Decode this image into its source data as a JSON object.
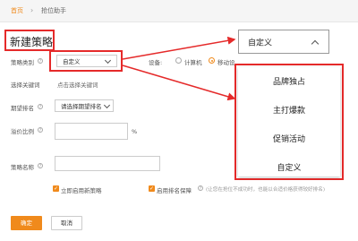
{
  "breadcrumb": {
    "home": "首页",
    "separator": "›",
    "current": "抢位助手"
  },
  "page_title": "新建策略",
  "form": {
    "strategy_type_label": "策略类别",
    "strategy_type_value": "自定义",
    "device_label": "设备:",
    "device_options": [
      "计算机",
      "移动设"
    ],
    "device_selected": "移动设",
    "keyword_label": "选择关键词",
    "keyword_link": "点击选择关键词",
    "rank_label": "期望排名",
    "rank_value": "请选择期望排名",
    "price_ratio_label": "溢价比例",
    "percent_sign": "%",
    "name_label": "策略名称",
    "enable_label": "立即启用新策略",
    "guarantee_label": "启用排名保障",
    "guarantee_note": "(让您在抢位不成功时，也能以合适价格获得较好排名)"
  },
  "buttons": {
    "ok": "确定",
    "cancel": "取消"
  },
  "dropdown_zoom": {
    "selected": "自定义",
    "options": [
      "品牌独占",
      "主打爆款",
      "促销活动",
      "自定义"
    ]
  },
  "colors": {
    "accent": "#f08a1c",
    "annotation_red": "#e52a2a"
  }
}
